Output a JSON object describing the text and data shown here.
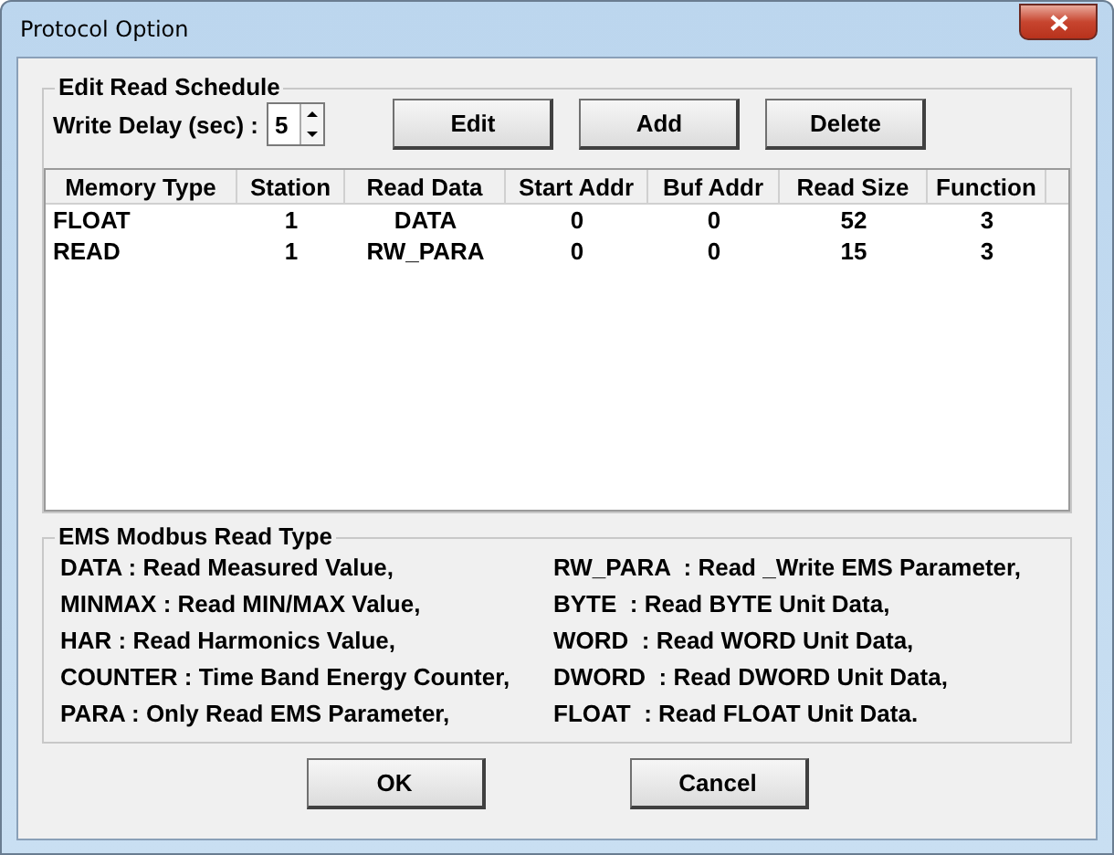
{
  "window": {
    "title": "Protocol Option"
  },
  "schedule": {
    "title": "Edit Read Schedule",
    "delay_label": "Write Delay (sec) :",
    "delay_value": "5",
    "buttons": [
      "Edit",
      "Add",
      "Delete"
    ]
  },
  "table": {
    "columns": [
      "Memory Type",
      "Station",
      "Read Data",
      "Start Addr",
      "Buf Addr",
      "Read Size",
      "Function"
    ],
    "rows": [
      [
        "FLOAT",
        "1",
        "DATA",
        "0",
        "0",
        "52",
        "3"
      ],
      [
        "READ",
        "1",
        "RW_PARA",
        "0",
        "0",
        "15",
        "3"
      ]
    ]
  },
  "read_types": {
    "title": "EMS Modbus Read Type",
    "left": [
      "DATA : Read Measured Value,",
      "MINMAX : Read MIN/MAX Value,",
      "HAR : Read Harmonics Value,",
      "COUNTER : Time Band Energy Counter,",
      "PARA : Only Read EMS Parameter,"
    ],
    "right": [
      "RW_PARA  : Read _Write EMS Parameter,",
      "BYTE  : Read BYTE Unit Data,",
      "WORD  : Read WORD Unit Data,",
      "DWORD  : Read DWORD Unit Data,",
      "FLOAT  : Read FLOAT Unit Data."
    ]
  },
  "buttons": [
    "OK",
    "Cancel"
  ]
}
